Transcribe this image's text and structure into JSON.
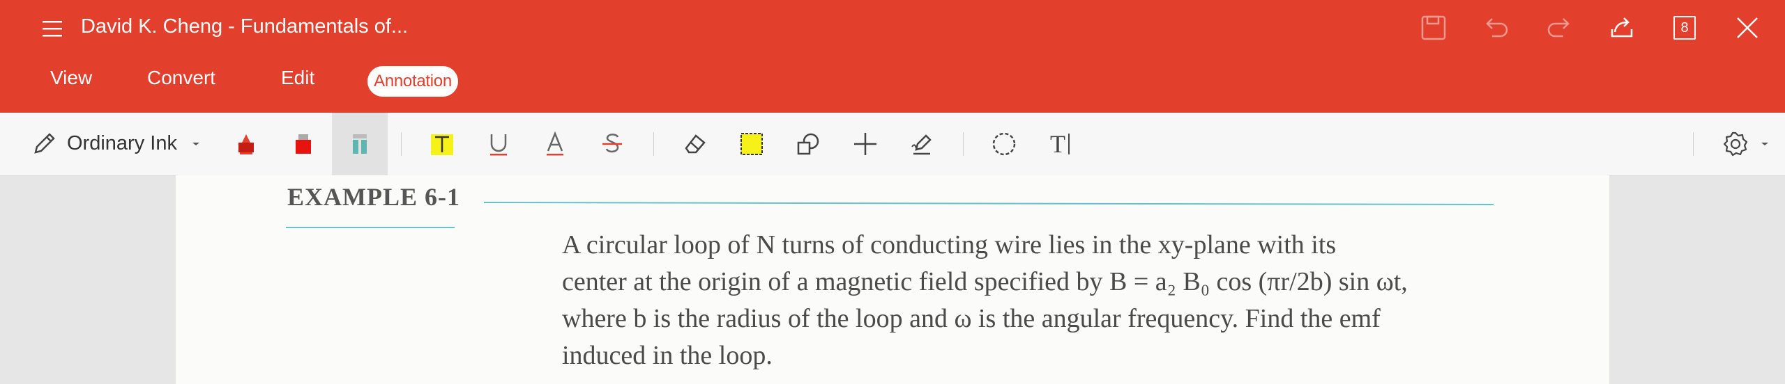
{
  "header": {
    "doc_title": "David K. Cheng - Fundamentals of...",
    "page_count": "8"
  },
  "nav": {
    "tabs": [
      {
        "label": "View"
      },
      {
        "label": "Convert"
      },
      {
        "label": "Edit"
      },
      {
        "label": "Annotation"
      }
    ],
    "active": "Annotation"
  },
  "toolbar": {
    "ink_label": "Ordinary Ink",
    "text_tool_label": "T"
  },
  "document": {
    "example_title": "EXAMPLE 6-1",
    "lines": [
      "A circular loop of N turns of conducting wire lies in the xy-plane with its",
      "center at the origin of a magnetic field specified by B = a₂ B₀ cos (πr/2b) sin ωt,",
      "where b is the radius of the loop and ω is the angular frequency. Find the emf",
      "induced in the loop."
    ]
  },
  "colors": {
    "accent": "#e23f2d",
    "teal_annotation": "#68c2c6",
    "highlight_yellow": "#f7f11a"
  }
}
